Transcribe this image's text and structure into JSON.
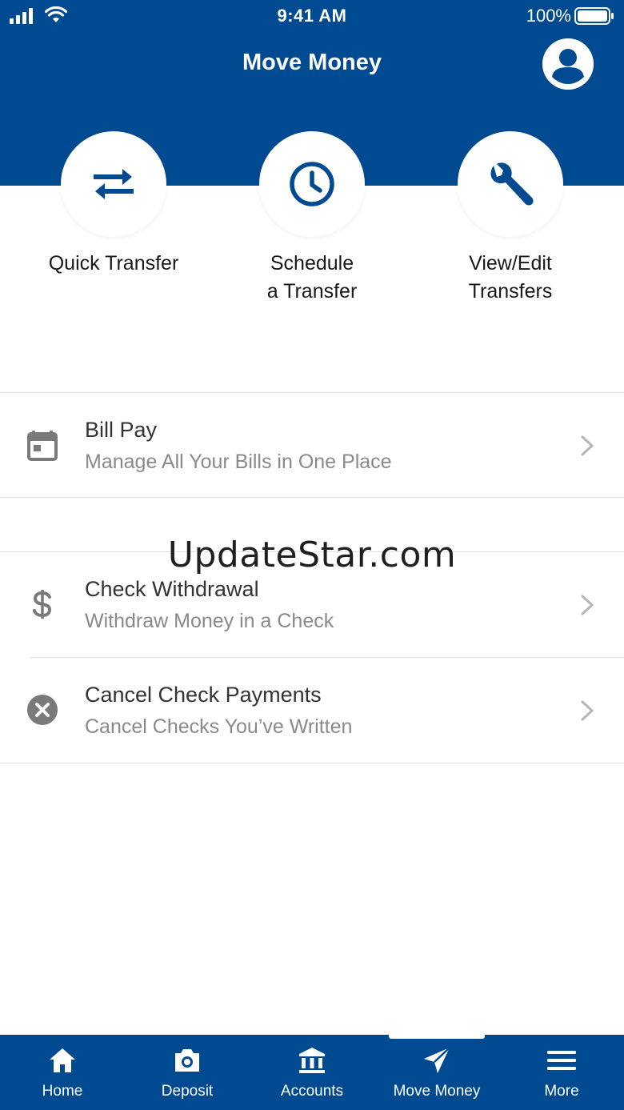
{
  "status_bar": {
    "time": "9:41 AM",
    "battery_percent": "100%"
  },
  "header": {
    "title": "Move Money",
    "profile_icon": "user-circle-icon"
  },
  "quick_actions": [
    {
      "label_line1": "Quick Transfer",
      "label_line2": "",
      "icon": "swap-arrows-icon"
    },
    {
      "label_line1": "Schedule",
      "label_line2": "a Transfer",
      "icon": "clock-icon"
    },
    {
      "label_line1": "View/Edit",
      "label_line2": "Transfers",
      "icon": "wrench-icon"
    }
  ],
  "list_items": [
    {
      "title": "Bill Pay",
      "subtitle": "Manage All Your Bills in One Place",
      "icon": "calendar-icon"
    },
    {
      "title": "Check Withdrawal",
      "subtitle": "Withdraw Money in a Check",
      "icon": "dollar-icon"
    },
    {
      "title": "Cancel Check Payments",
      "subtitle": "Cancel Checks You’ve Written",
      "icon": "cancel-circle-icon"
    }
  ],
  "watermark": "UpdateStar.com",
  "tab_bar": {
    "active": "Move Money",
    "items": [
      {
        "label": "Home",
        "icon": "home-icon"
      },
      {
        "label": "Deposit",
        "icon": "camera-icon"
      },
      {
        "label": "Accounts",
        "icon": "bank-icon"
      },
      {
        "label": "Move Money",
        "icon": "paper-plane-icon"
      },
      {
        "label": "More",
        "icon": "menu-icon"
      }
    ]
  },
  "colors": {
    "brand_blue": "#004a92",
    "icon_gray": "#7a7a7a",
    "subtitle_gray": "#8a8a8a",
    "divider": "#e3e3e3"
  }
}
